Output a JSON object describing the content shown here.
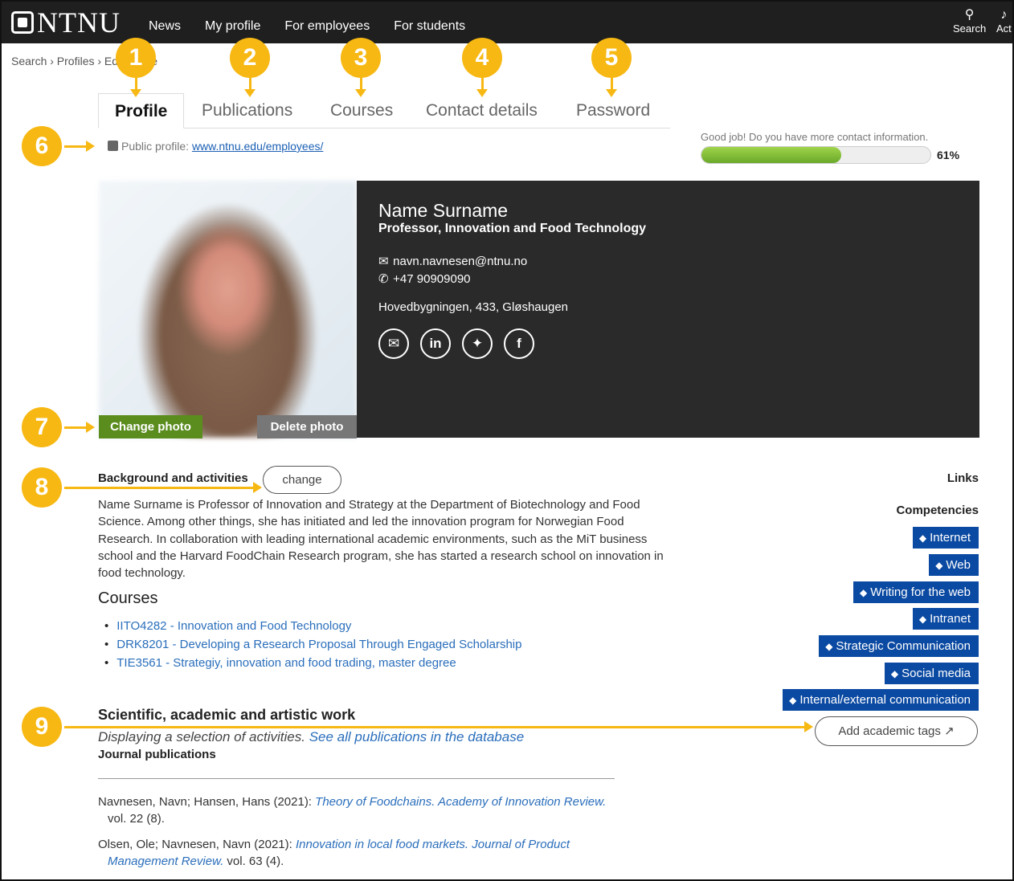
{
  "brand": {
    "logo_text": "NTNU"
  },
  "nav": {
    "items": [
      "News",
      "My profile",
      "For employees",
      "For students"
    ]
  },
  "top_actions": {
    "search_label": "Search",
    "activity_label": "Act"
  },
  "breadcrumb": {
    "text": "Search › Profiles › Edit profile"
  },
  "tabs": [
    "Profile",
    "Publications",
    "Courses",
    "Contact details",
    "Password"
  ],
  "public_profile": {
    "label": "Public profile:",
    "url_text": "www.ntnu.edu/employees/"
  },
  "progress": {
    "message": "Good job! Do you have more contact information.",
    "percent_label": "61%",
    "value": 61
  },
  "photo": {
    "change_label": "Change photo",
    "delete_label": "Delete photo"
  },
  "card": {
    "name": "Name Surname",
    "title": "Professor, Innovation and Food Technology",
    "email": "navn.navnesen@ntnu.no",
    "phone": "+47 90909090",
    "office": "Hovedbygningen, 433, Gløshaugen",
    "socials": [
      "email-icon",
      "linkedin-icon",
      "twitter-icon",
      "facebook-icon"
    ]
  },
  "background": {
    "title": "Background and activities",
    "change_label": "change",
    "text": "Name Surname is Professor of Innovation and Strategy at the Department of Biotechnology and Food Science. Among other things, she has initiated and led the innovation program for Norwegian Food Research. In collaboration with leading international academic environments, such as the MiT business school and the Harvard FoodChain Research program, she has started a research school on innovation in food technology."
  },
  "courses": {
    "heading": "Courses",
    "items": [
      "IITO4282 - Innovation and Food Technology",
      "DRK8201 - Developing a Research Proposal Through Engaged Scholarship",
      "TIE3561 - Strategiy, innovation and food trading, master degree"
    ]
  },
  "scientific": {
    "heading": "Scientific, academic and artistic work",
    "sub_text": "Displaying a selection of activities.",
    "sub_link": "See all publications in the database",
    "journal_heading": "Journal publications",
    "refs": [
      {
        "authors": "Navnesen, Navn; Hansen, Hans (2021):",
        "title": "Theory of Foodchains. Academy of Innovation Review.",
        "tail": "vol. 22 (8)."
      },
      {
        "authors": "Olsen, Ole; Navnesen, Navn (2021):",
        "title": "Innovation in local food markets. Journal of Product",
        "title2": "Management Review.",
        "tail": "vol. 63 (4)."
      }
    ]
  },
  "sidebar": {
    "links_heading": "Links",
    "competencies_heading": "Competencies",
    "tags": [
      "Internet",
      "Web",
      "Writing for the web",
      "Intranet",
      "Strategic Communication",
      "Social media",
      "Internal/external communication"
    ],
    "academic_tags_label": "Add academic tags"
  },
  "callouts": [
    "1",
    "2",
    "3",
    "4",
    "5",
    "6",
    "7",
    "8",
    "9"
  ],
  "colors": {
    "callout": "#f7b813",
    "tag": "#0b4aa2",
    "topbar": "#1f1f1f",
    "card": "#2a2a2a",
    "change_photo": "#5a8c1e"
  }
}
